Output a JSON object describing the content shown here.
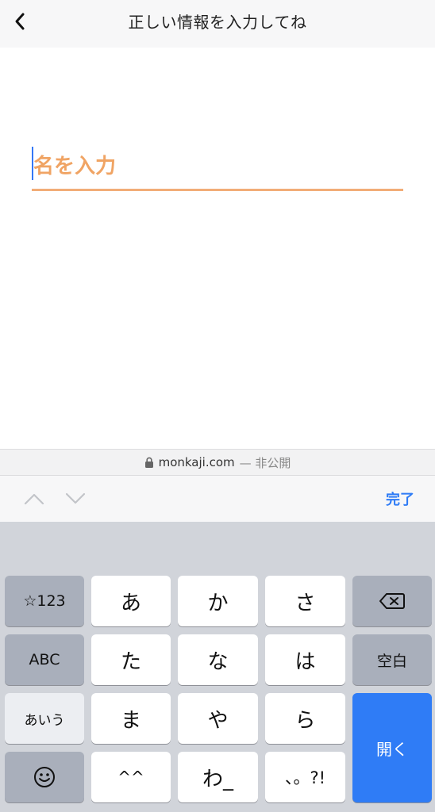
{
  "header": {
    "title": "正しい情報を入力してね"
  },
  "form": {
    "placeholder": "名を入力"
  },
  "url_bar": {
    "domain": "monkaji.com",
    "note": "— 非公開"
  },
  "accessory": {
    "done_label": "完了"
  },
  "keyboard": {
    "left": [
      "☆123",
      "ABC",
      "あいう"
    ],
    "grid": [
      [
        "あ",
        "か",
        "さ"
      ],
      [
        "た",
        "な",
        "は"
      ],
      [
        "ま",
        "や",
        "ら"
      ],
      [
        "^^",
        "わ_",
        "、。?!"
      ]
    ],
    "space_label": "空白",
    "enter_label": "開く"
  },
  "colors": {
    "accent": "#2f7cf6",
    "placeholder": "#f0a464",
    "underline": "#f2ad78",
    "keyboard_bg": "#d1d4da"
  },
  "icons": [
    "chevron-left-icon",
    "lock-icon",
    "chevron-up-icon",
    "chevron-down-icon",
    "backspace-icon",
    "emoji-icon"
  ]
}
